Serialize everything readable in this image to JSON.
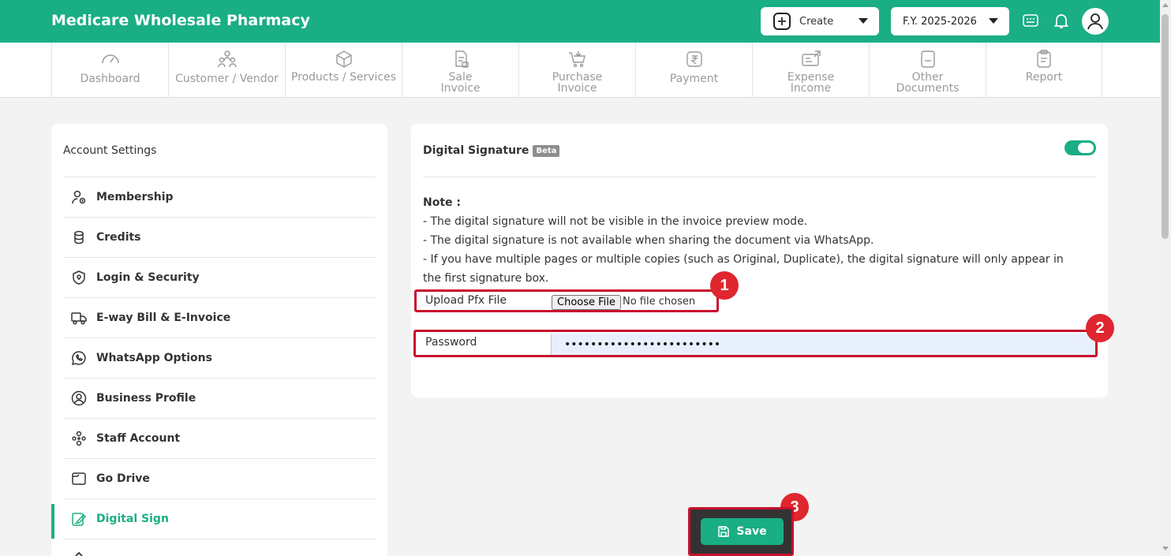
{
  "header": {
    "app_title": "Medicare Wholesale Pharmacy",
    "create_label": "Create",
    "fy_label": "F.Y. 2025-2026",
    "icons": [
      "plus-icon",
      "chevron-down-icon",
      "calculator-icon",
      "bell-icon",
      "user-avatar-icon"
    ]
  },
  "nav": {
    "items": [
      {
        "label": "Dashboard",
        "icon": "gauge-icon"
      },
      {
        "label": "Customer / Vendor",
        "icon": "users-icon"
      },
      {
        "label": "Products / Services",
        "icon": "box-icon"
      },
      {
        "label": "Sale Invoice",
        "line1": "Sale",
        "line2": "Invoice",
        "icon": "sale-invoice-icon"
      },
      {
        "label": "Purchase Invoice",
        "line1": "Purchase",
        "line2": "Invoice",
        "icon": "cart-icon"
      },
      {
        "label": "Payment",
        "icon": "rupee-icon"
      },
      {
        "label": "Expense Income",
        "line1": "Expense",
        "line2": "Income",
        "icon": "expense-icon"
      },
      {
        "label": "Other Documents",
        "line1": "Other",
        "line2": "Documents",
        "icon": "document-icon"
      },
      {
        "label": "Report",
        "icon": "clipboard-icon"
      }
    ]
  },
  "sidebar": {
    "title": "Account Settings",
    "items": [
      {
        "label": "Membership",
        "icon": "membership-icon"
      },
      {
        "label": "Credits",
        "icon": "coins-icon"
      },
      {
        "label": "Login & Security",
        "icon": "shield-icon"
      },
      {
        "label": "E-way Bill & E-Invoice",
        "icon": "truck-icon"
      },
      {
        "label": "WhatsApp Options",
        "icon": "whatsapp-icon"
      },
      {
        "label": "Business Profile",
        "icon": "user-circle-icon"
      },
      {
        "label": "Staff Account",
        "icon": "staff-icon"
      },
      {
        "label": "Go Drive",
        "icon": "folder-icon"
      },
      {
        "label": "Digital Sign",
        "icon": "edit-sign-icon",
        "active": true
      }
    ]
  },
  "digital_signature": {
    "title": "Digital Signature",
    "beta": "Beta",
    "enabled": true,
    "note_title": "Note :",
    "note_lines": [
      "- The digital signature will not be visible in the invoice preview mode.",
      "- The digital signature is not available when sharing the document via WhatsApp.",
      "- If you have multiple pages or multiple copies (such as Original, Duplicate), the digital signature will only appear in the first signature box."
    ],
    "upload_label": "Upload Pfx File",
    "choose_file": "Choose File",
    "no_file": "No file chosen",
    "password_label": "Password",
    "password_value": "••••••••••••••••••••••••"
  },
  "save_label": "Save",
  "badges": [
    "1",
    "2",
    "3"
  ],
  "colors": {
    "brand": "#1aae84",
    "highlight": "#c8102e",
    "badge": "#e0262e"
  }
}
